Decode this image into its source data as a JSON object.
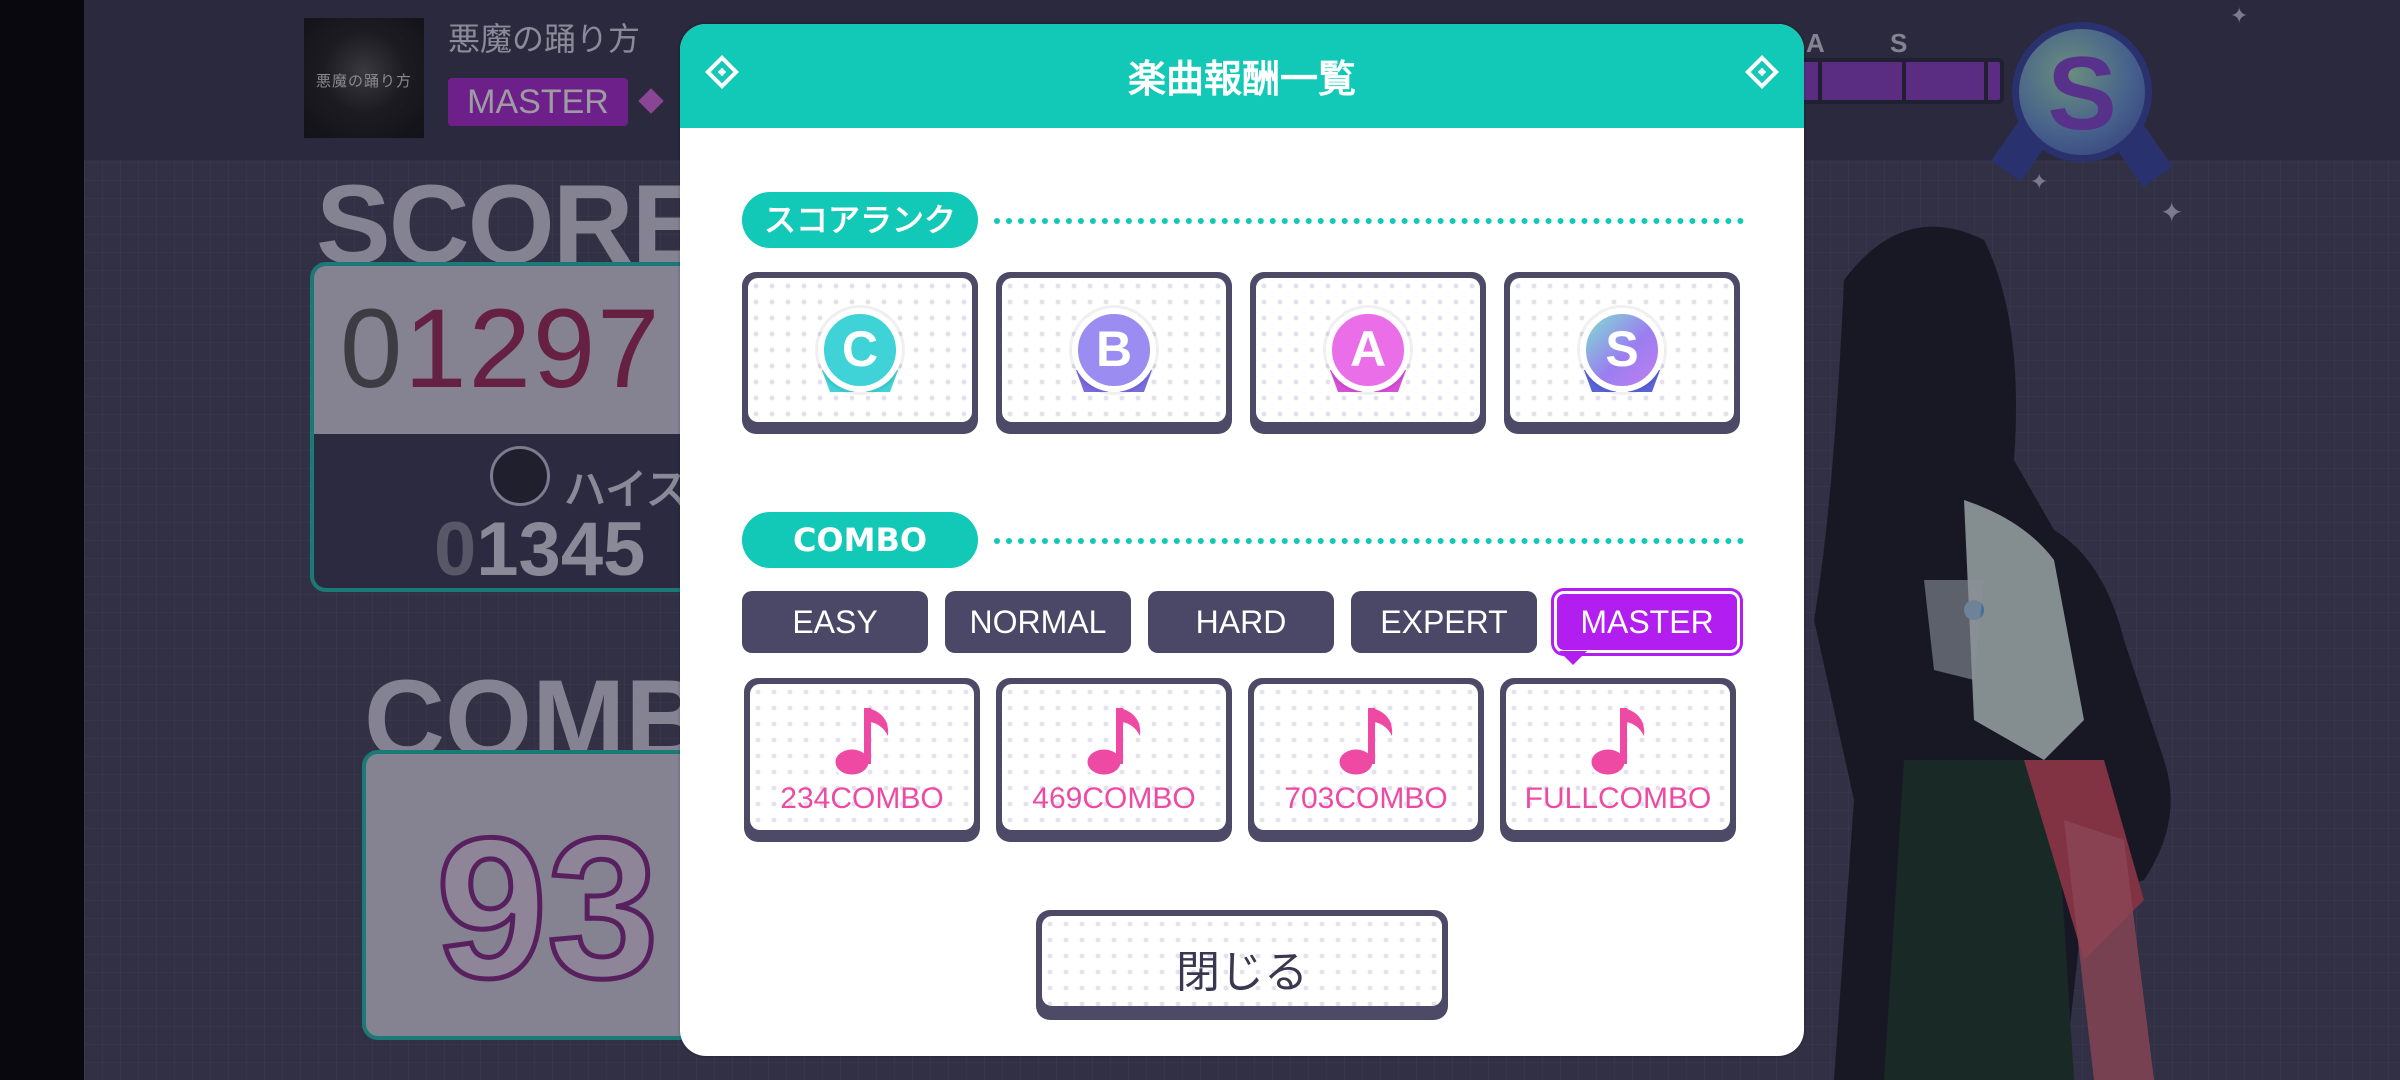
{
  "background": {
    "song": {
      "jacket_text": "悪魔の踊り方",
      "title": "悪魔の踊り方",
      "difficulty": "MASTER"
    },
    "rank_gauge": {
      "letters": [
        "A",
        "S"
      ],
      "current_rank": "S"
    },
    "score": {
      "label": "SCORE",
      "value_dim": "0",
      "value": "1297",
      "highscore_label": "ハイスコ",
      "highscore_dim": "0",
      "highscore_value": "1345"
    },
    "combo": {
      "label": "COMB",
      "value": "93"
    }
  },
  "modal": {
    "title": "楽曲報酬一覧",
    "score_rank_section": "スコアランク",
    "score_ranks": [
      {
        "letter": "C",
        "color": "#3fd3d8"
      },
      {
        "letter": "B",
        "color": "#9a8cf0"
      },
      {
        "letter": "A",
        "color": "#ea6ee8"
      },
      {
        "letter": "S",
        "color": "#9a7ef0"
      }
    ],
    "combo_section": "COMBO",
    "difficulty_tabs": [
      "EASY",
      "NORMAL",
      "HARD",
      "EXPERT",
      "MASTER"
    ],
    "active_tab": "MASTER",
    "combo_rewards": [
      "234COMBO",
      "469COMBO",
      "703COMBO",
      "FULLCOMBO"
    ],
    "close_label": "閉じる",
    "colors": {
      "accent": "#12c8b6",
      "active_tab": "#b21ef0",
      "tab": "#4a4866",
      "note": "#ee4aa4"
    }
  }
}
